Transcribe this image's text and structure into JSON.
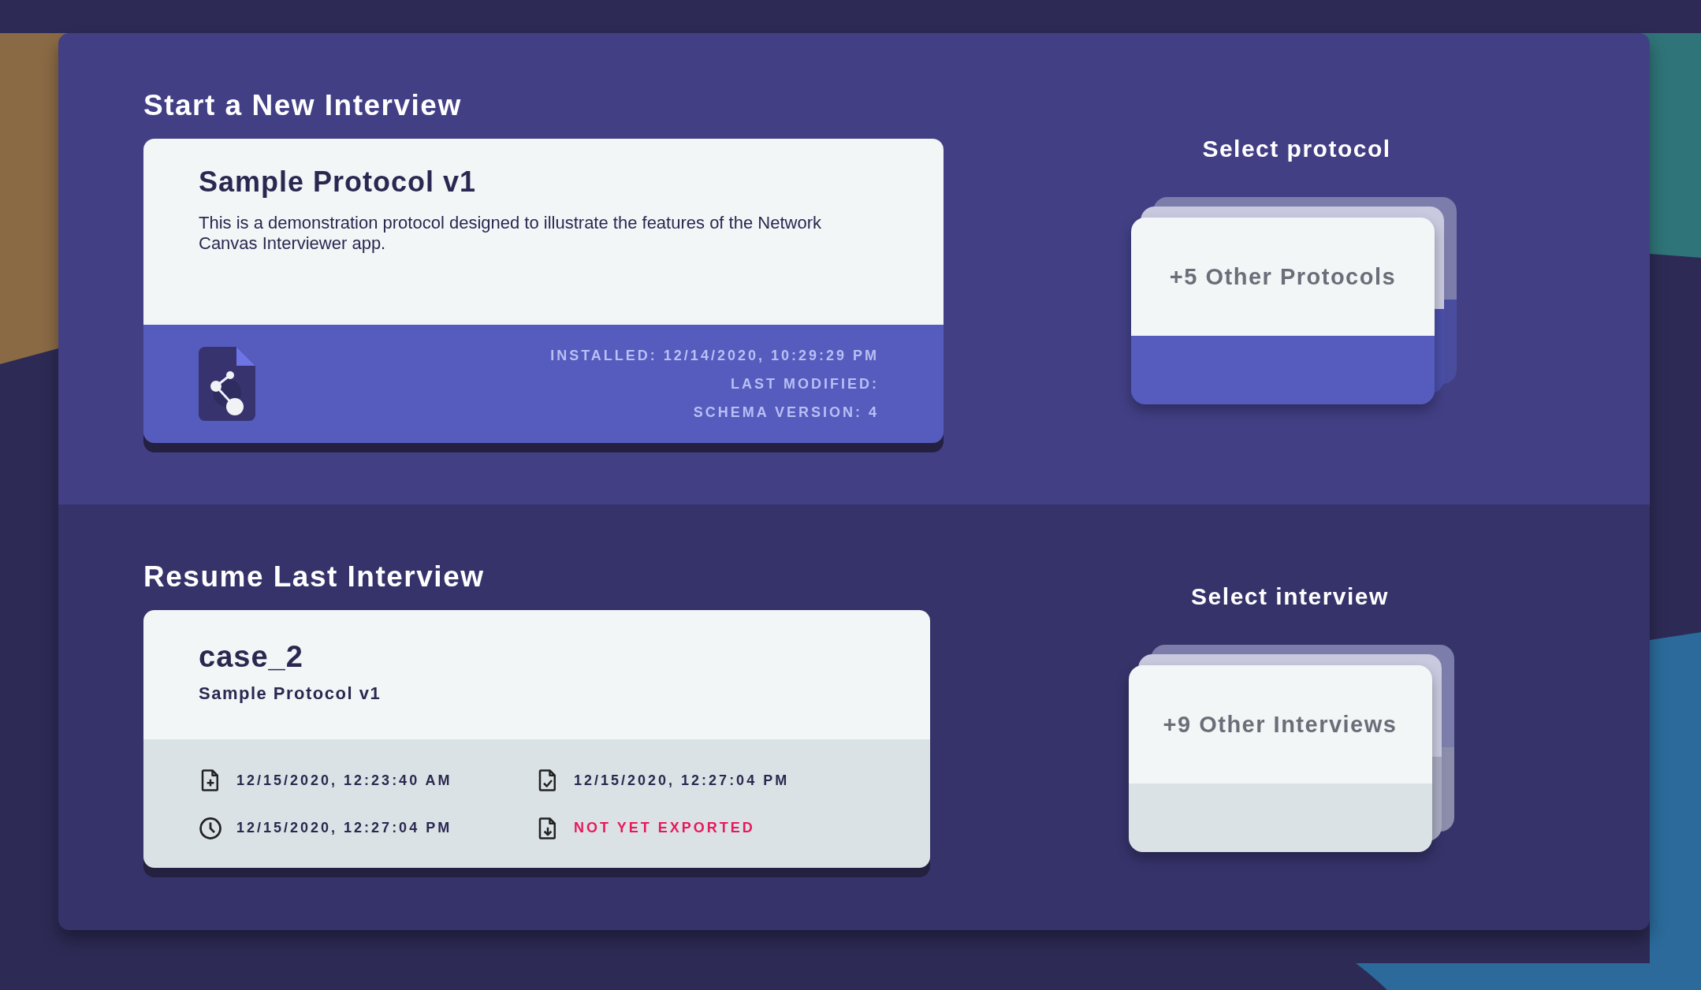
{
  "new_interview": {
    "heading": "Start a New Interview",
    "protocol_card": {
      "title": "Sample Protocol v1",
      "description": "This is a demonstration protocol designed to illustrate the features of the Network Canvas Interviewer app.",
      "meta": [
        "INSTALLED: 12/14/2020, 10:29:29 PM",
        "LAST MODIFIED:",
        "SCHEMA VERSION: 4"
      ]
    },
    "selector": {
      "label": "Select protocol",
      "count_text": "+5 Other Protocols"
    }
  },
  "resume_interview": {
    "heading": "Resume Last Interview",
    "session_card": {
      "case_id": "case_2",
      "protocol": "Sample Protocol v1",
      "details": [
        {
          "kind": "created",
          "text": "12/15/2020, 12:23:40 AM"
        },
        {
          "kind": "finished",
          "text": "12/15/2020, 12:27:04 PM"
        },
        {
          "kind": "modified",
          "text": "12/15/2020, 12:27:04 PM"
        },
        {
          "kind": "not_exported",
          "text": "NOT YET EXPORTED"
        }
      ]
    },
    "selector": {
      "label": "Select interview",
      "count_text": "+9 Other Interviews"
    }
  }
}
